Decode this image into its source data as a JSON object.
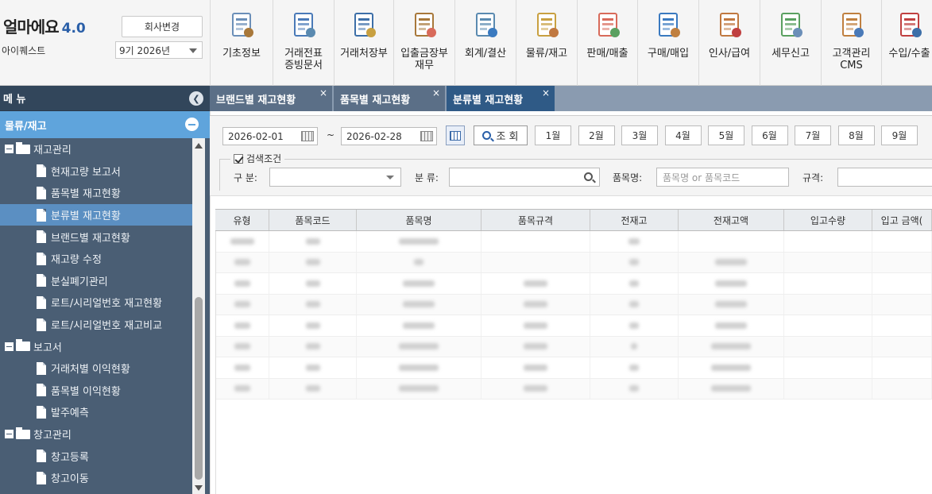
{
  "header": {
    "brand": "얼마에요",
    "version": "4.0",
    "company": "아이퀘스트",
    "change_company_btn": "회사변경",
    "period": "9기 2026년"
  },
  "topnav": [
    {
      "label": "기초정보",
      "icon": "basic-info-icon",
      "w": 79
    },
    {
      "label": "거래전표\n증빙문서",
      "icon": "voucher-icon",
      "w": 77
    },
    {
      "label": "거래처장부",
      "icon": "ledger-icon",
      "w": 75
    },
    {
      "label": "입출금장부\n재무",
      "icon": "money-bag-icon",
      "w": 77
    },
    {
      "label": "회계/결산",
      "icon": "accounting-icon",
      "w": 77
    },
    {
      "label": "물류/재고",
      "icon": "logistics-icon",
      "w": 77
    },
    {
      "label": "판매/매출",
      "icon": "sales-icon",
      "w": 76
    },
    {
      "label": "구매/매입",
      "icon": "purchase-icon",
      "w": 77
    },
    {
      "label": "인사/급여",
      "icon": "hr-icon",
      "w": 77
    },
    {
      "label": "세무신고",
      "icon": "tax-icon",
      "w": 77
    },
    {
      "label": "고객관리\nCMS",
      "icon": "customer-icon",
      "w": 76
    },
    {
      "label": "수입/수출",
      "icon": "ship-icon",
      "w": 70
    }
  ],
  "sidebar": {
    "title": "메 뉴",
    "category": "물류/재고",
    "tree": [
      {
        "type": "folder",
        "label": "재고관리"
      },
      {
        "type": "leaf",
        "label": "현재고량 보고서"
      },
      {
        "type": "leaf",
        "label": "품목별 재고현황"
      },
      {
        "type": "leaf",
        "label": "분류별 재고현황",
        "active": true
      },
      {
        "type": "leaf",
        "label": "브랜드별 재고현황"
      },
      {
        "type": "leaf",
        "label": "재고량 수정"
      },
      {
        "type": "leaf",
        "label": "분실폐기관리"
      },
      {
        "type": "leaf",
        "label": "로트/시리얼번호 재고현황"
      },
      {
        "type": "leaf",
        "label": "로트/시리얼번호 재고비교"
      },
      {
        "type": "folder",
        "label": "보고서"
      },
      {
        "type": "leaf",
        "label": "거래처별 이익현황"
      },
      {
        "type": "leaf",
        "label": "품목별 이익현황"
      },
      {
        "type": "leaf",
        "label": "발주예측"
      },
      {
        "type": "folder",
        "label": "창고관리"
      },
      {
        "type": "leaf",
        "label": "창고등록"
      },
      {
        "type": "leaf",
        "label": "창고이동"
      }
    ]
  },
  "tabs": [
    {
      "label": "브랜드별 재고현황",
      "active": false
    },
    {
      "label": "품목별 재고현황",
      "active": false
    },
    {
      "label": "분류별 재고현황",
      "active": true
    }
  ],
  "search": {
    "date_from": "2026-02-01",
    "tilde": "~",
    "date_to": "2026-02-28",
    "search_btn": "조 회",
    "months": [
      "1월",
      "2월",
      "3월",
      "4월",
      "5월",
      "6월",
      "7월",
      "8월",
      "9월"
    ],
    "legend": "검색조건",
    "gubun_label": "구 분:",
    "bunryu_label": "분 류:",
    "pummok_label": "품목명:",
    "pummok_placeholder": "품목명 or 품목코드",
    "gyugyeok_label": "규격:"
  },
  "grid": {
    "columns": [
      "유형",
      "품목코드",
      "품목명",
      "품목규격",
      "전재고",
      "전재고액",
      "입고수량",
      "입고 금액("
    ],
    "row_count": 8
  },
  "colors": {
    "sidebar_bg": "#4a5e74",
    "category_bar": "#5fa4dc",
    "active_tab": "#2f5a86",
    "accent": "#2a5fa8"
  }
}
